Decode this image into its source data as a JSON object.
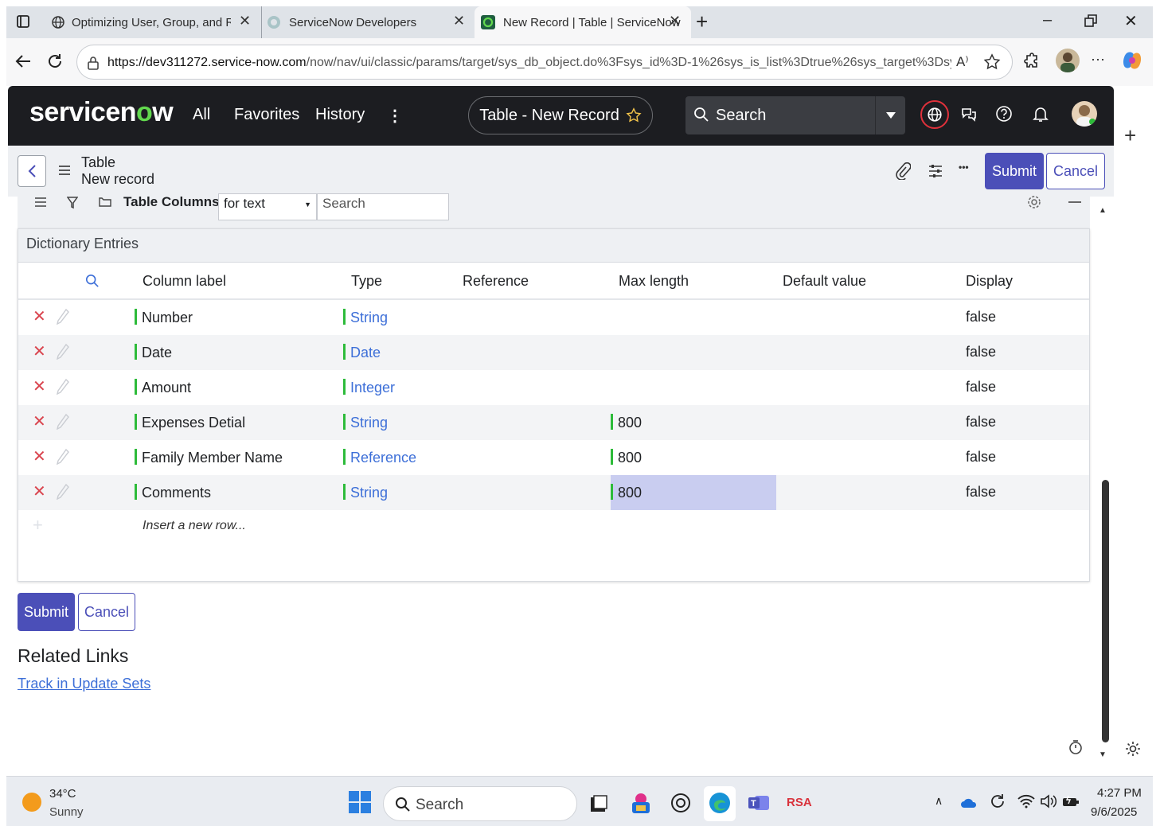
{
  "browser": {
    "tabs": [
      {
        "title": "Optimizing User, Group, and Role"
      },
      {
        "title": "ServiceNow Developers"
      },
      {
        "title": "New Record | Table | ServiceNow"
      }
    ],
    "url_host": "https://dev311272.service-now.com",
    "url_path": "/now/nav/ui/classic/params/target/sys_db_object.do%3Fsys_id%3D-1%26sys_is_list%3Dtrue%26sys_target%3Dsys_...",
    "reader_label": "A⁾"
  },
  "sn_header": {
    "logo_prefix": "servicen",
    "logo_o": "o",
    "logo_suffix": "w",
    "nav": [
      "All",
      "Favorites",
      "History"
    ],
    "more": "⋮",
    "context_pill": "Table - New Record",
    "search_label": "Search"
  },
  "record": {
    "line1": "Table",
    "line2": "New record",
    "submit": "Submit",
    "cancel": "Cancel",
    "more": "•••"
  },
  "list_toolbar": {
    "label": "Table Columns",
    "filter_value": "for text",
    "search_placeholder": "Search"
  },
  "dictionary": {
    "title": "Dictionary Entries",
    "columns": [
      "Column label",
      "Type",
      "Reference",
      "Max length",
      "Default value",
      "Display"
    ],
    "rows": [
      {
        "label": "Number",
        "type": "String",
        "max": "",
        "display": "false"
      },
      {
        "label": "Date",
        "type": "Date",
        "max": "",
        "display": "false"
      },
      {
        "label": "Amount",
        "type": "Integer",
        "max": "",
        "display": "false"
      },
      {
        "label": "Expenses Detial",
        "type": "String",
        "max": "800",
        "display": "false"
      },
      {
        "label": "Family Member Name",
        "type": "Reference",
        "max": "800",
        "display": "false"
      },
      {
        "label": "Comments",
        "type": "String",
        "max": "800",
        "display": "false"
      }
    ],
    "insert_row": "Insert a new row..."
  },
  "bottom": {
    "submit": "Submit",
    "cancel": "Cancel",
    "related_title": "Related Links",
    "related_link": "Track in Update Sets"
  },
  "taskbar": {
    "temp": "34°C",
    "weather": "Sunny",
    "search": "Search",
    "rsa": "RSA",
    "time": "4:27 PM",
    "date": "9/6/2025"
  },
  "colors": {
    "sn_header_bg": "#1c1d21",
    "brand_green": "#62d84e",
    "primary": "#4b4fb8",
    "link": "#3d6fd8",
    "delete": "#d9434d",
    "status_bar": "#2dbb3a"
  }
}
